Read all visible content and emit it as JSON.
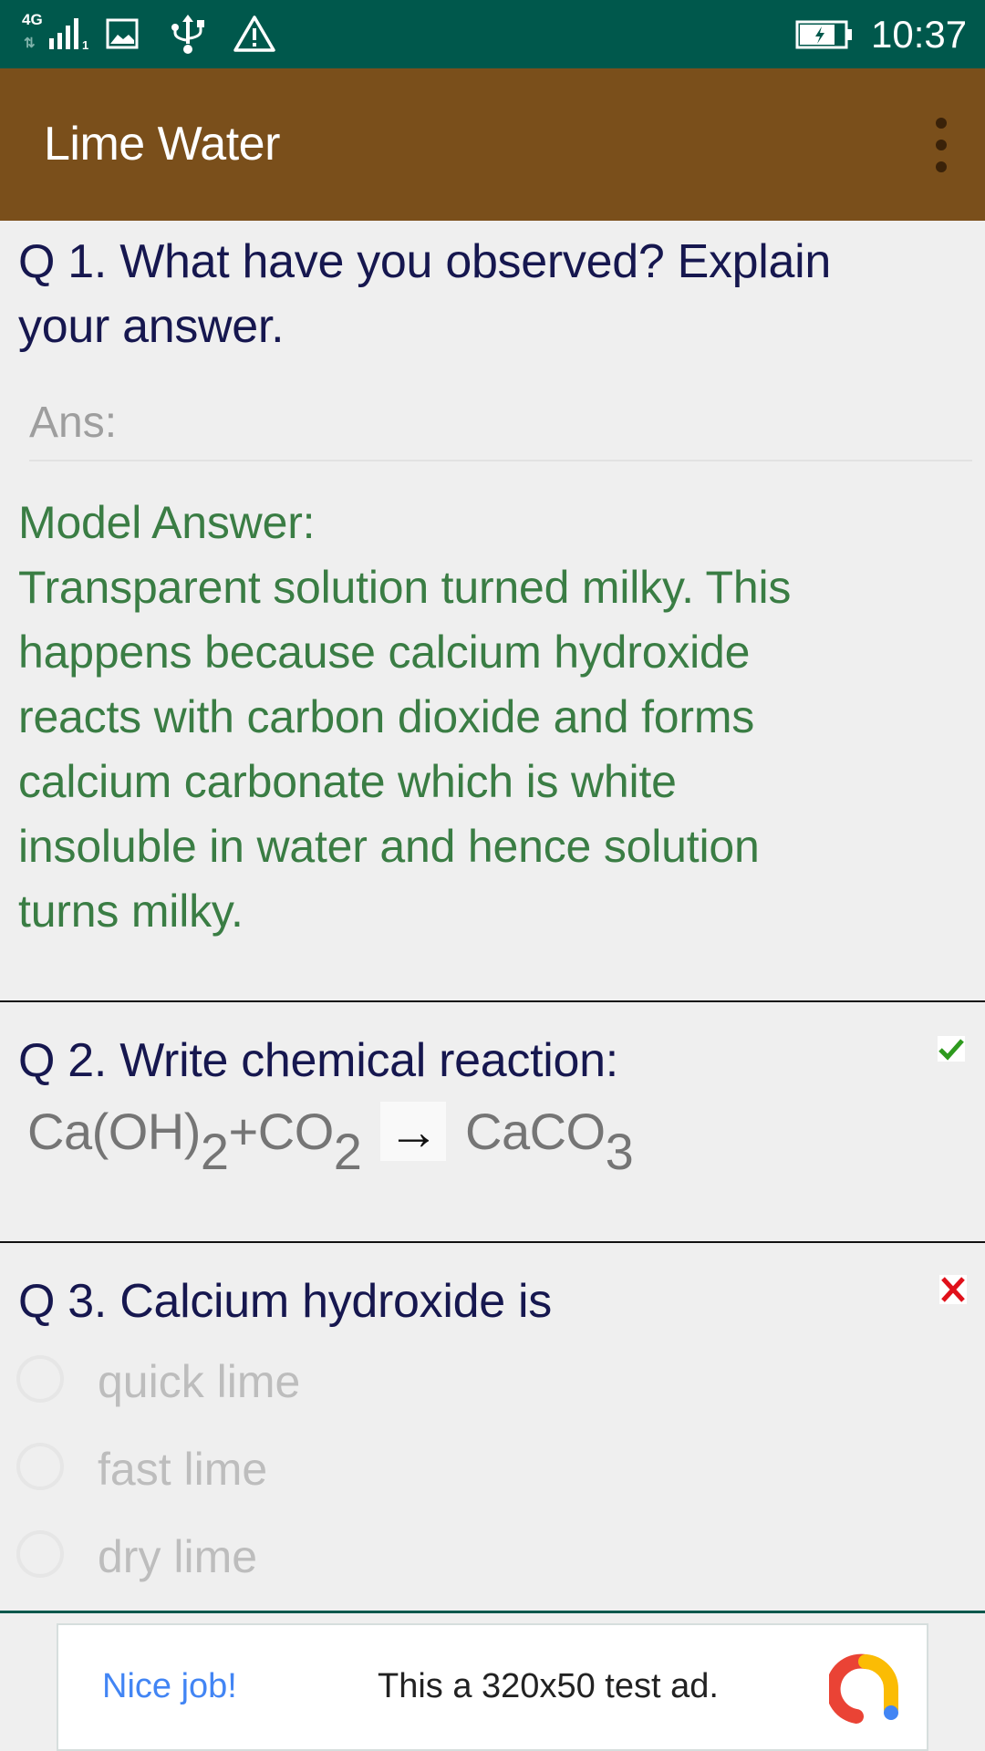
{
  "status_bar": {
    "network": "4G",
    "sim_slot": "1",
    "time": "10:37",
    "icons": [
      "signal-icon",
      "image-icon",
      "usb-icon",
      "warning-icon",
      "battery-charging-icon"
    ]
  },
  "app_bar": {
    "title": "Lime Water",
    "menu_icon": "more-vert-icon"
  },
  "colors": {
    "status_bar": "#00584C",
    "app_bar": "#7A4F1B",
    "question_text": "#16174F",
    "model_answer": "#3A7D44",
    "correct": "#2E9A1E",
    "wrong": "#E0101A"
  },
  "questions": [
    {
      "number": "Q 1.",
      "text_line1": "Q 1. What have you observed? Explain",
      "text_line2": "your answer.",
      "answer_placeholder": "Ans:",
      "answer_value": "",
      "model_answer_label": "Model Answer:",
      "model_answer_lines": [
        "Transparent solution turned milky. This",
        "happens because calcium hydroxide",
        "reacts with carbon dioxide and forms",
        "calcium carbonate which is white",
        "insoluble in water and hence solution",
        "turns milky."
      ]
    },
    {
      "number": "Q 2.",
      "text": "Q 2. Write chemical reaction:",
      "status": "correct",
      "status_icon": "check-icon",
      "equation": {
        "reactant1": "Ca(OH)",
        "reactant1_sub": "2",
        "plus": "+",
        "reactant2": "CO",
        "reactant2_sub": "2",
        "arrow": "→",
        "product": "CaCO",
        "product_sub": "3"
      }
    },
    {
      "number": "Q 3.",
      "text": "Q 3. Calcium hydroxide is",
      "status": "wrong",
      "status_icon": "cross-icon",
      "options": [
        "quick lime",
        "fast lime",
        "dry lime"
      ]
    }
  ],
  "ad": {
    "headline": "Nice job!",
    "body": "This a 320x50 test ad.",
    "logo": "admob-logo-icon"
  }
}
